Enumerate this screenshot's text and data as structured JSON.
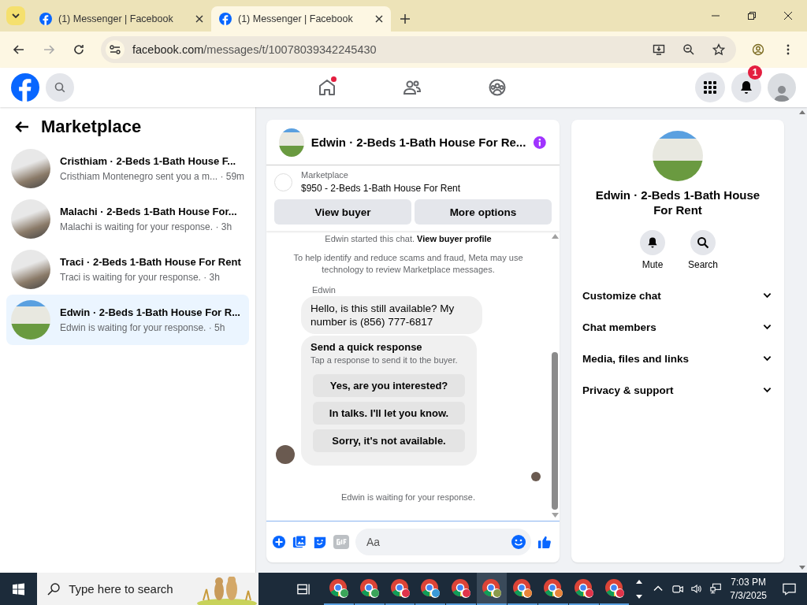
{
  "browser": {
    "tabs": [
      {
        "title": "(1) Messenger | Facebook",
        "selected": false
      },
      {
        "title": "(1) Messenger | Facebook",
        "selected": true
      }
    ],
    "url_domain": "facebook.com",
    "url_path": "/messages/t/10078039342245430"
  },
  "header": {
    "nav": [
      {
        "kind": "home",
        "selected": false,
        "dot": true
      },
      {
        "kind": "friends",
        "selected": false,
        "dot": false
      },
      {
        "kind": "groups",
        "selected": false,
        "dot": false
      }
    ],
    "notification_count": "1"
  },
  "sidebar": {
    "title": "Marketplace",
    "conversations": [
      {
        "name": "Cristhiam · 2-Beds 1-Bath House F...",
        "preview": "Cristhiam Montenegro sent you a m...",
        "time": "· 59m",
        "selected": false
      },
      {
        "name": "Malachi · 2-Beds 1-Bath House For...",
        "preview": "Malachi is waiting for your response.",
        "time": "· 3h",
        "selected": false
      },
      {
        "name": "Traci · 2-Beds 1-Bath House For Rent",
        "preview": "Traci is waiting for your response.",
        "time": "· 3h",
        "selected": false
      },
      {
        "name": "Edwin · 2-Beds 1-Bath House For R...",
        "preview": "Edwin is waiting for your response.",
        "time": "· 5h",
        "selected": true
      }
    ]
  },
  "chat": {
    "title": "Edwin · 2-Beds 1-Bath House For Re...",
    "listing_label": "Marketplace",
    "listing_title": "$950 - 2-Beds 1-Bath House For Rent",
    "buttons": [
      "View buyer",
      "More options"
    ],
    "started": "Edwin started this chat.",
    "started_link": "View buyer profile",
    "notice": "To help identify and reduce scams and fraud, Meta may use technology to review Marketplace messages.",
    "sender": "Edwin",
    "message": "Hello, is this still available? My number is (856) 777-6817",
    "quick_title": "Send a quick response",
    "quick_hint": "Tap a response to send it to the buyer.",
    "quick_replies": [
      "Yes, are you interested?",
      "In talks. I'll let you know.",
      "Sorry, it's not available."
    ],
    "status": "Edwin is waiting for your response.",
    "composer_placeholder": "Aa"
  },
  "details": {
    "title": "Edwin · 2-Beds 1-Bath House For Rent",
    "actions": [
      {
        "kind": "mute",
        "label": "Mute"
      },
      {
        "kind": "search",
        "label": "Search"
      }
    ],
    "sections": [
      {
        "label": "Customize chat",
        "expanded": false
      },
      {
        "label": "Chat members",
        "expanded": false
      },
      {
        "label": "Media, files and links",
        "expanded": false
      },
      {
        "label": "Privacy & support",
        "expanded": false
      }
    ]
  },
  "taskbar": {
    "search_placeholder": "Type here to search",
    "apps": [
      {
        "color": "#3aa55a",
        "selected": false
      },
      {
        "color": "#3aa55a",
        "selected": false
      },
      {
        "color": "#e0344a",
        "selected": false
      },
      {
        "color": "#3a9ad8",
        "selected": false
      },
      {
        "color": "#e0344a",
        "selected": false
      },
      {
        "color": "#8a9a4a",
        "selected": true
      },
      {
        "color": "#e8843a",
        "selected": false
      },
      {
        "color": "#e8843a",
        "selected": false
      },
      {
        "color": "#e0344a",
        "selected": false
      },
      {
        "color": "#e0344a",
        "selected": false
      }
    ],
    "time": "7:03 PM",
    "date": "7/3/2025"
  }
}
